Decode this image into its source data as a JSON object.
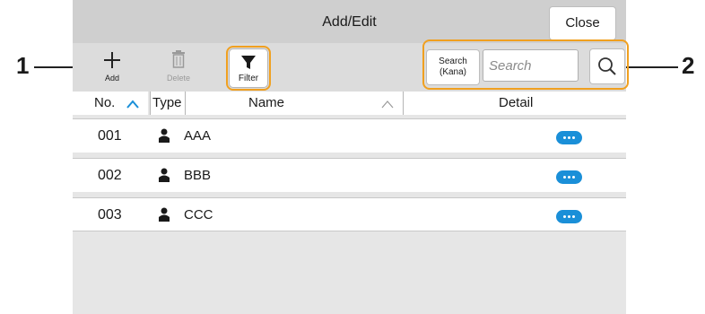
{
  "titlebar": {
    "title": "Add/Edit",
    "close_label": "Close"
  },
  "toolbar": {
    "add_label": "Add",
    "delete_label": "Delete",
    "filter_label": "Filter",
    "search_kana_line1": "Search",
    "search_kana_line2": "(Kana)",
    "search_placeholder": "Search"
  },
  "table": {
    "headers": {
      "no": "No.",
      "type": "Type",
      "name": "Name",
      "detail": "Detail"
    },
    "rows": [
      {
        "no": "001",
        "name": "AAA"
      },
      {
        "no": "002",
        "name": "BBB"
      },
      {
        "no": "003",
        "name": "CCC"
      }
    ]
  },
  "callouts": {
    "one": "1",
    "two": "2"
  },
  "colors": {
    "accent": "#1a8fd8",
    "highlight": "#f0a020"
  },
  "icons": {
    "add": "plus-icon",
    "delete": "trash-icon",
    "filter": "funnel-icon",
    "search": "magnifier-icon",
    "type": "person-icon",
    "detail": "more-dots-icon",
    "sort": "chevron-up-icon"
  }
}
